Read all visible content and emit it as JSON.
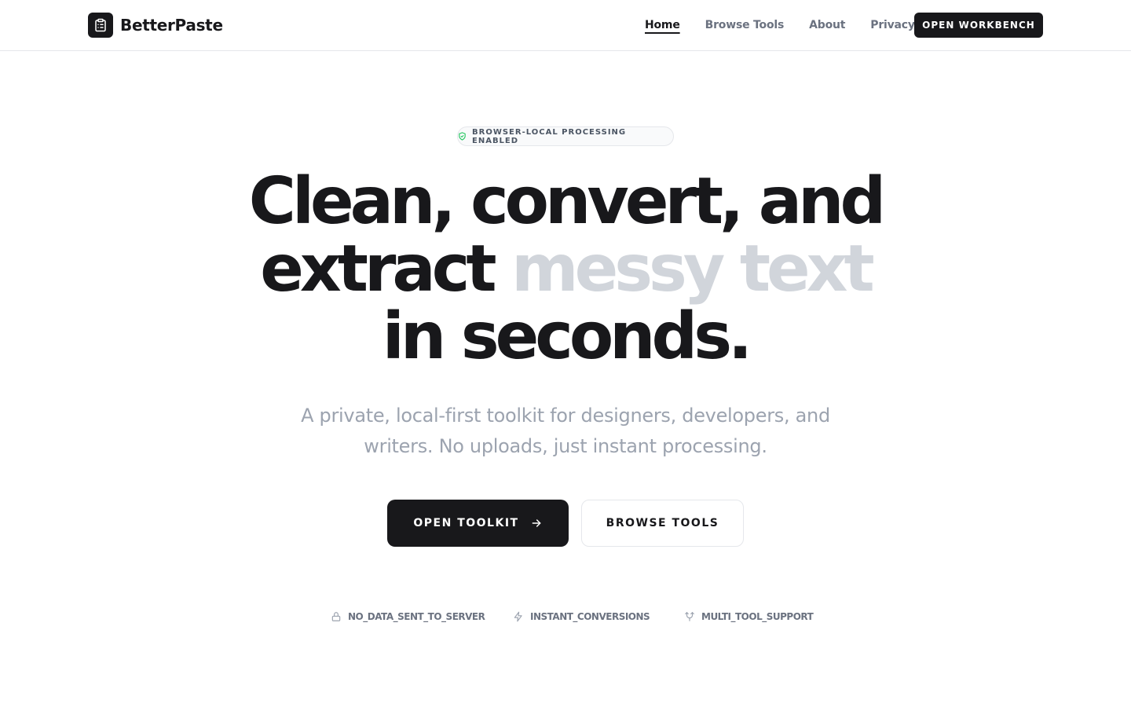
{
  "brand": {
    "name": "BetterPaste",
    "logo_icon": "clipboard-icon"
  },
  "nav": {
    "links": [
      {
        "label": "Home",
        "active": true
      },
      {
        "label": "Browse Tools",
        "active": false
      },
      {
        "label": "About",
        "active": false
      },
      {
        "label": "Privacy",
        "active": false
      }
    ],
    "cta_label": "OPEN WORKBENCH"
  },
  "hero": {
    "badge": {
      "icon": "shield-check-icon",
      "label": "BROWSER-LOCAL PROCESSING ENABLED",
      "icon_color": "#22c55e"
    },
    "headline": {
      "line1": "Clean, convert, and",
      "line2_dark": "extract",
      "line2_muted": "messy text",
      "line3": "in seconds."
    },
    "subtitle": "A private, local-first toolkit for designers, developers, and writers. No uploads, just instant processing.",
    "primary_button": {
      "label": "OPEN TOOLKIT",
      "icon": "arrow-right-icon"
    },
    "secondary_button": {
      "label": "BROWSE TOOLS"
    },
    "features": [
      {
        "icon": "lock-icon",
        "label": "NO_DATA_SENT_TO_SERVER"
      },
      {
        "icon": "lightning-icon",
        "label": "INSTANT_CONVERSIONS"
      },
      {
        "icon": "branch-icon",
        "label": "MULTI_TOOL_SUPPORT"
      }
    ]
  },
  "colors": {
    "text_dark": "#18181b",
    "text_muted_headline": "#d1d5db",
    "text_gray": "#6b7280",
    "border": "#e5e7eb"
  }
}
